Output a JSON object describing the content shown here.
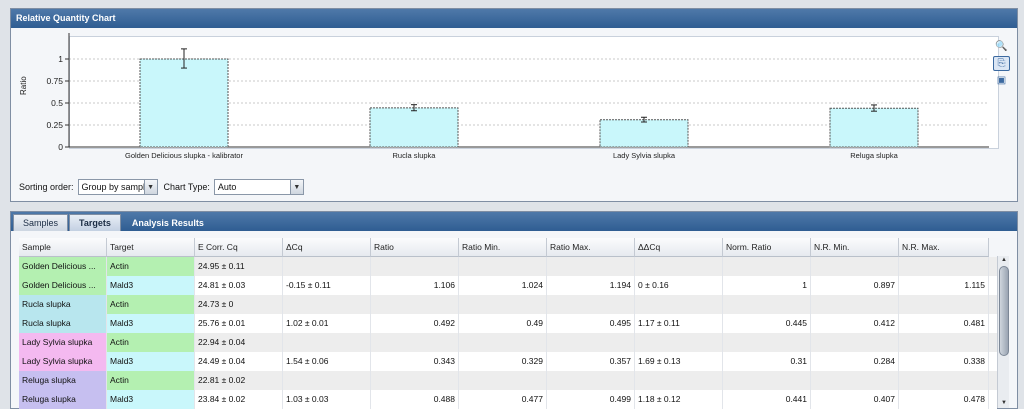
{
  "top_panel": {
    "title": "Relative Quantity Chart",
    "sorting_label": "Sorting order:",
    "sorting_value": "Group by samples",
    "chart_type_label": "Chart Type:",
    "chart_type_value": "Auto",
    "tools": [
      {
        "icon": "zoom-in-icon",
        "glyph": "🔍"
      },
      {
        "icon": "export-chart-icon",
        "glyph": "⎘"
      },
      {
        "icon": "copy-image-icon",
        "glyph": "▣"
      }
    ]
  },
  "chart_data": {
    "type": "bar",
    "ylabel": "Ratio",
    "ylim": [
      0,
      1.25
    ],
    "yticks": [
      "0",
      "0.25",
      "0.5",
      "0.75",
      "1"
    ],
    "grid": true,
    "categories": [
      "Golden Delicious slupka  - kalibrator",
      "Rucla slupka",
      "Lady Sylvia slupka",
      "Reluga slupka"
    ],
    "values": [
      1,
      0.445,
      0.31,
      0.441
    ],
    "error_min": [
      0.897,
      0.412,
      0.284,
      0.407
    ],
    "error_max": [
      1.115,
      0.481,
      0.338,
      0.478
    ],
    "bar_color": "#c9f7fb"
  },
  "bottom_panel": {
    "tabs": [
      {
        "label": "Samples",
        "style": "normal"
      },
      {
        "label": "Targets",
        "style": "selected"
      },
      {
        "label": "Analysis Results",
        "style": "plain"
      }
    ],
    "table": {
      "headers": [
        "Sample",
        "Target",
        "E Corr. Cq",
        "ΔCq",
        "Ratio",
        "Ratio Min.",
        "Ratio Max.",
        "ΔΔCq",
        "Norm. Ratio",
        "N.R. Min.",
        "N.R. Max."
      ],
      "rows": [
        {
          "sample": "Golden Delicious ...",
          "target": "Actin",
          "ecorr": "24.95 ± 0.11",
          "dcq": "",
          "ratio": "",
          "rmin": "",
          "rmax": "",
          "ddcq": "",
          "nratio": "",
          "nrmin": "",
          "nrmax": "",
          "sample_color": "#b4f0b1",
          "target_color": "#b4f0b1"
        },
        {
          "sample": "Golden Delicious ...",
          "target": "Mald3",
          "ecorr": "24.81 ± 0.03",
          "dcq": "-0.15 ± 0.11",
          "ratio": "1.106",
          "rmin": "1.024",
          "rmax": "1.194",
          "ddcq": "0 ± 0.16",
          "nratio": "1",
          "nrmin": "0.897",
          "nrmax": "1.115",
          "sample_color": "#b4f0b1",
          "target_color": "#c9f7fb"
        },
        {
          "sample": "Rucla slupka",
          "target": "Actin",
          "ecorr": "24.73 ± 0",
          "dcq": "",
          "ratio": "",
          "rmin": "",
          "rmax": "",
          "ddcq": "",
          "nratio": "",
          "nrmin": "",
          "nrmax": "",
          "sample_color": "#b8e6ee",
          "target_color": "#b4f0b1"
        },
        {
          "sample": "Rucla slupka",
          "target": "Mald3",
          "ecorr": "25.76 ± 0.01",
          "dcq": "1.02 ± 0.01",
          "ratio": "0.492",
          "rmin": "0.49",
          "rmax": "0.495",
          "ddcq": "1.17 ± 0.11",
          "nratio": "0.445",
          "nrmin": "0.412",
          "nrmax": "0.481",
          "sample_color": "#b8e6ee",
          "target_color": "#c9f7fb"
        },
        {
          "sample": "Lady Sylvia slupka",
          "target": "Actin",
          "ecorr": "22.94 ± 0.04",
          "dcq": "",
          "ratio": "",
          "rmin": "",
          "rmax": "",
          "ddcq": "",
          "nratio": "",
          "nrmin": "",
          "nrmax": "",
          "sample_color": "#f4b9f0",
          "target_color": "#b4f0b1"
        },
        {
          "sample": "Lady Sylvia slupka",
          "target": "Mald3",
          "ecorr": "24.49 ± 0.04",
          "dcq": "1.54 ± 0.06",
          "ratio": "0.343",
          "rmin": "0.329",
          "rmax": "0.357",
          "ddcq": "1.69 ± 0.13",
          "nratio": "0.31",
          "nrmin": "0.284",
          "nrmax": "0.338",
          "sample_color": "#f4b9f0",
          "target_color": "#c9f7fb"
        },
        {
          "sample": "Reluga slupka",
          "target": "Actin",
          "ecorr": "22.81 ± 0.02",
          "dcq": "",
          "ratio": "",
          "rmin": "",
          "rmax": "",
          "ddcq": "",
          "nratio": "",
          "nrmin": "",
          "nrmax": "",
          "sample_color": "#c6bff0",
          "target_color": "#b4f0b1"
        },
        {
          "sample": "Reluga slupka",
          "target": "Mald3",
          "ecorr": "23.84 ± 0.02",
          "dcq": "1.03 ± 0.03",
          "ratio": "0.488",
          "rmin": "0.477",
          "rmax": "0.499",
          "ddcq": "1.18 ± 0.12",
          "nratio": "0.441",
          "nrmin": "0.407",
          "nrmax": "0.478",
          "sample_color": "#c6bff0",
          "target_color": "#c9f7fb"
        }
      ]
    }
  }
}
